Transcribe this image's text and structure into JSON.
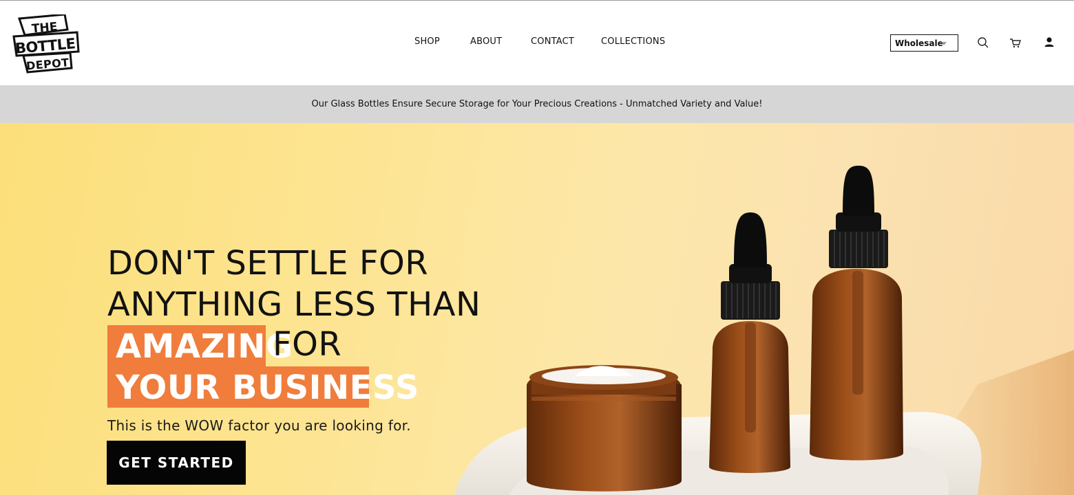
{
  "brand": {
    "logo_lines": [
      "THE",
      "BOTTLE",
      "DEPOT"
    ]
  },
  "nav": {
    "items": [
      "SHOP",
      "ABOUT",
      "CONTACT",
      "COLLECTIONS"
    ]
  },
  "header": {
    "store_select": {
      "value": "Wholesale"
    },
    "icons": [
      "search-icon",
      "cart-icon",
      "account-icon"
    ]
  },
  "announcement": {
    "text": "Our Glass Bottles Ensure Secure Storage for Your Precious Creations - Unmatched Variety and Value!"
  },
  "hero": {
    "line1": "DON'T SETTLE FOR",
    "line2": "ANYTHING LESS THAN",
    "highlight1": "AMAZING",
    "line3_rest": "FOR",
    "highlight2": "YOUR BUSINESS",
    "subheadline": "This is the WOW factor you are looking for.",
    "cta_label": "GET STARTED"
  },
  "colors": {
    "accent": "#f07d3c",
    "announce_bg": "#d6d6d6",
    "cta_bg": "#050505",
    "hero_bg": "#fde491"
  }
}
